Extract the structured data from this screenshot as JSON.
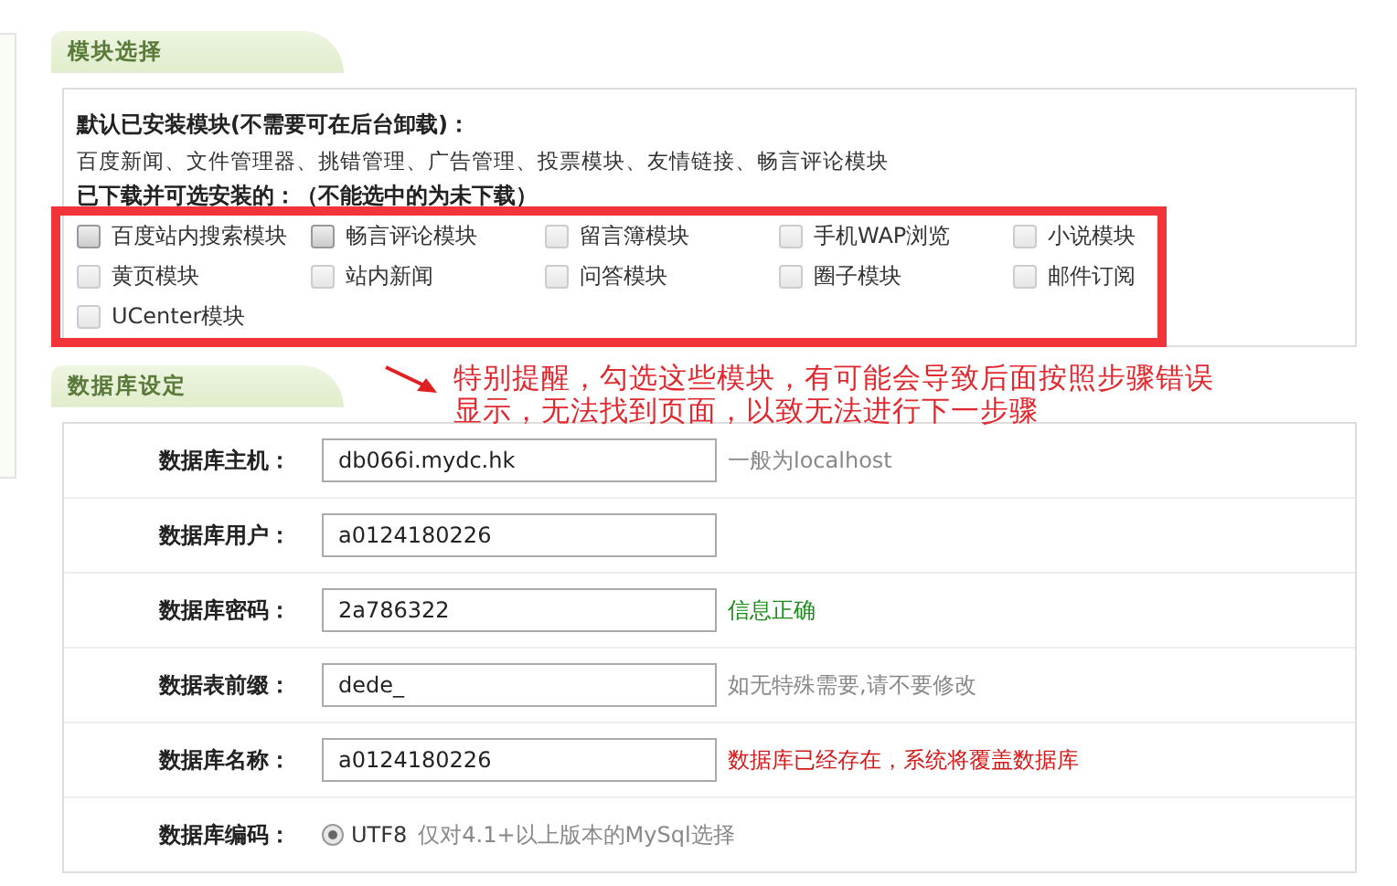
{
  "module_section": {
    "title": "模块选择",
    "default_heading": "默认已安装模块(不需要可在后台卸载)：",
    "default_list": "百度新闻、文件管理器、挑错管理、广告管理、投票模块、友情链接、畅言评论模块",
    "optional_heading": "已下载并可选安装的：（不能选中的为未下载）",
    "modules": [
      {
        "label": "百度站内搜索模块",
        "checked": false,
        "disabled": false
      },
      {
        "label": "畅言评论模块",
        "checked": false,
        "disabled": false
      },
      {
        "label": "留言簿模块",
        "checked": false,
        "disabled": true
      },
      {
        "label": "手机WAP浏览",
        "checked": false,
        "disabled": true
      },
      {
        "label": "小说模块",
        "checked": false,
        "disabled": true
      },
      {
        "label": "黄页模块",
        "checked": false,
        "disabled": true
      },
      {
        "label": "站内新闻",
        "checked": false,
        "disabled": true
      },
      {
        "label": "问答模块",
        "checked": false,
        "disabled": true
      },
      {
        "label": "圈子模块",
        "checked": false,
        "disabled": true
      },
      {
        "label": "邮件订阅",
        "checked": false,
        "disabled": true
      },
      {
        "label": "UCenter模块",
        "checked": false,
        "disabled": true
      }
    ]
  },
  "annotation": {
    "text": "特别提醒，勾选这些模块，有可能会导致后面按照步骤错误显示，无法找到页面，以致无法进行下一步骤"
  },
  "database_section": {
    "title": "数据库设定",
    "rows": [
      {
        "kind": "input",
        "label": "数据库主机：",
        "value": "db066i.mydc.hk",
        "note": {
          "text": "一般为localhost",
          "color": "#888888"
        }
      },
      {
        "kind": "input",
        "label": "数据库用户：",
        "value": "a0124180226"
      },
      {
        "kind": "input",
        "label": "数据库密码：",
        "value": "2a786322",
        "note": {
          "text": "信息正确",
          "color": "#1a8a1a"
        }
      },
      {
        "kind": "input",
        "label": "数据表前缀：",
        "value": "dede_",
        "note": {
          "text": "如无特殊需要,请不要修改",
          "color": "#888888"
        }
      },
      {
        "kind": "input",
        "label": "数据库名称：",
        "value": "a0124180226",
        "note": {
          "text": "数据库已经存在，系统将覆盖数据库",
          "color": "#d21a1a"
        }
      },
      {
        "kind": "radio",
        "label": "数据库编码：",
        "value": "UTF8",
        "selected": true,
        "note": {
          "text": "仅对4.1+以上版本的MySql选择",
          "color": "#888888"
        }
      }
    ]
  }
}
